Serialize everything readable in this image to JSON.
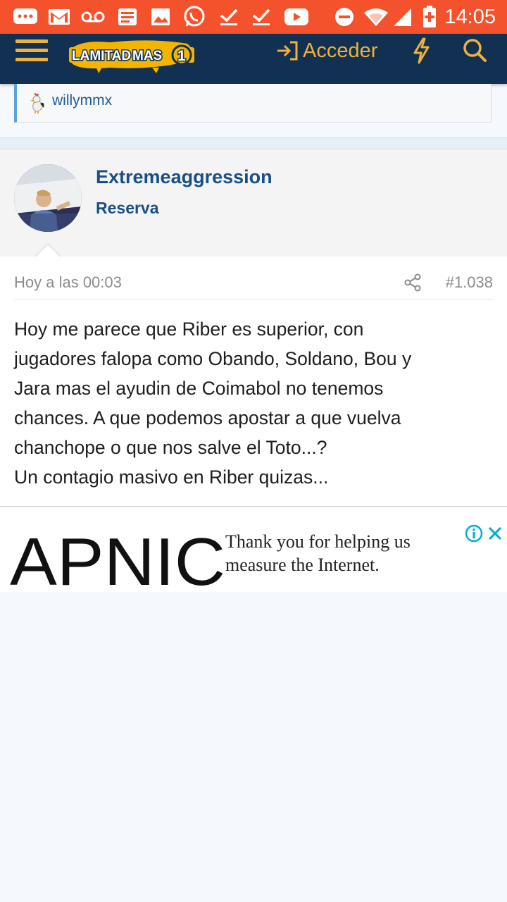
{
  "status_bar": {
    "time": "14:05",
    "icons": [
      "chat-icon",
      "gmail-icon",
      "voicemail-icon",
      "news-icon",
      "gallery-icon",
      "whatsapp-icon",
      "download-done-icon",
      "download-done-icon",
      "youtube-icon",
      "dnd-icon",
      "wifi-icon",
      "signal-icon",
      "battery-icon"
    ]
  },
  "header": {
    "logo_text_1": "LAMITAD",
    "logo_text_2": "MAS",
    "logo_text_3": "1",
    "login_label": "Acceder"
  },
  "quote": {
    "author": "willymmx"
  },
  "post": {
    "username": "Extremeaggression",
    "role": "Reserva",
    "date": "Hoy a las 00:03",
    "number": "#1.038",
    "lines": [
      "Hoy me parece que Riber es superior, con",
      "jugadores falopa como Obando, Soldano, Bou y",
      "Jara mas el ayudin de Coimabol no tenemos",
      "chances. A que podemos apostar a que vuelva",
      "chanchope o que nos salve el Toto...?",
      "Un contagio masivo en Riber quizas..."
    ]
  },
  "ad": {
    "brand": "APNIC",
    "text_line1": "Thank you for helping us",
    "text_line2": "measure the Internet."
  },
  "colors": {
    "status_bar": "#f4522d",
    "app_bar": "#123052",
    "accent": "#f0b23a",
    "link": "#1a4f85"
  }
}
